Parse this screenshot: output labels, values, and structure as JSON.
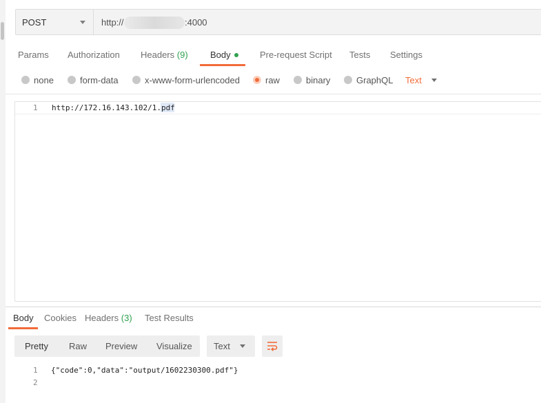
{
  "request": {
    "method": "POST",
    "url_prefix": "http://",
    "url_suffix": ":4000"
  },
  "tabs": [
    {
      "label": "Params"
    },
    {
      "label": "Authorization"
    },
    {
      "label": "Headers",
      "count": "(9)"
    },
    {
      "label": "Body"
    },
    {
      "label": "Pre-request Script"
    },
    {
      "label": "Tests"
    },
    {
      "label": "Settings"
    }
  ],
  "body_types": {
    "options": [
      "none",
      "form-data",
      "x-www-form-urlencoded",
      "raw",
      "binary",
      "GraphQL"
    ],
    "selected": "raw",
    "format": "Text"
  },
  "editor": {
    "lines": [
      {
        "num": "1",
        "text": "http://172.16.143.102/1.pdf"
      }
    ]
  },
  "response_tabs": [
    {
      "label": "Body"
    },
    {
      "label": "Cookies"
    },
    {
      "label": "Headers",
      "count": "(3)"
    },
    {
      "label": "Test Results"
    }
  ],
  "response_toolbar": {
    "views": [
      "Pretty",
      "Raw",
      "Preview",
      "Visualize"
    ],
    "format": "Text"
  },
  "response": {
    "lines": [
      {
        "num": "1",
        "text": "{\"code\":0,\"data\":\"output/1602230300.pdf\"}"
      },
      {
        "num": "2",
        "text": ""
      }
    ]
  },
  "colors": {
    "accent": "#f26b3a",
    "status_green": "#30a14e"
  }
}
